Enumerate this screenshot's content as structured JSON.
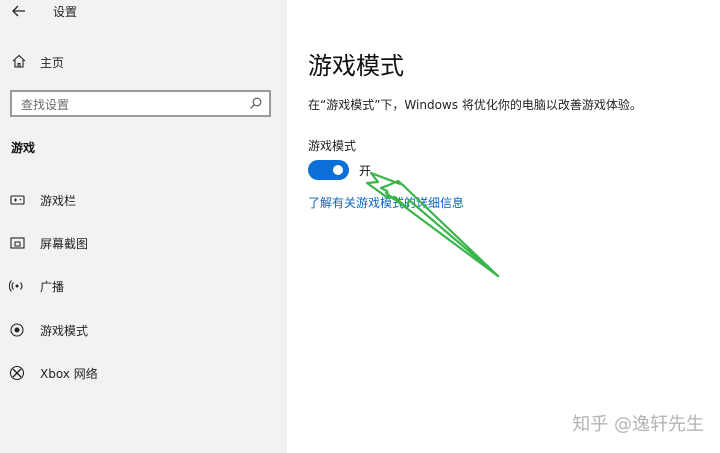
{
  "window": {
    "title": "设置"
  },
  "sidebar": {
    "home_label": "主页",
    "search_placeholder": "查找设置",
    "section_title": "游戏",
    "items": [
      {
        "label": "游戏栏",
        "icon": "game-bar-icon"
      },
      {
        "label": "屏幕截图",
        "icon": "screenshot-icon"
      },
      {
        "label": "广播",
        "icon": "broadcast-icon"
      },
      {
        "label": "游戏模式",
        "icon": "game-mode-icon"
      },
      {
        "label": "Xbox 网络",
        "icon": "xbox-icon"
      }
    ]
  },
  "main": {
    "title": "游戏模式",
    "description": "在“游戏模式”下，Windows 将优化你的电脑以改善游戏体验。",
    "toggle": {
      "label": "游戏模式",
      "state": "开",
      "on": true
    },
    "link": "了解有关游戏模式的详细信息"
  },
  "colors": {
    "accent": "#0a6fd6",
    "link": "#0a66c2",
    "sidebar_bg": "#f2f2f2",
    "annotation_arrow": "#3ab54a"
  },
  "watermark": "知乎 @逸轩先生"
}
